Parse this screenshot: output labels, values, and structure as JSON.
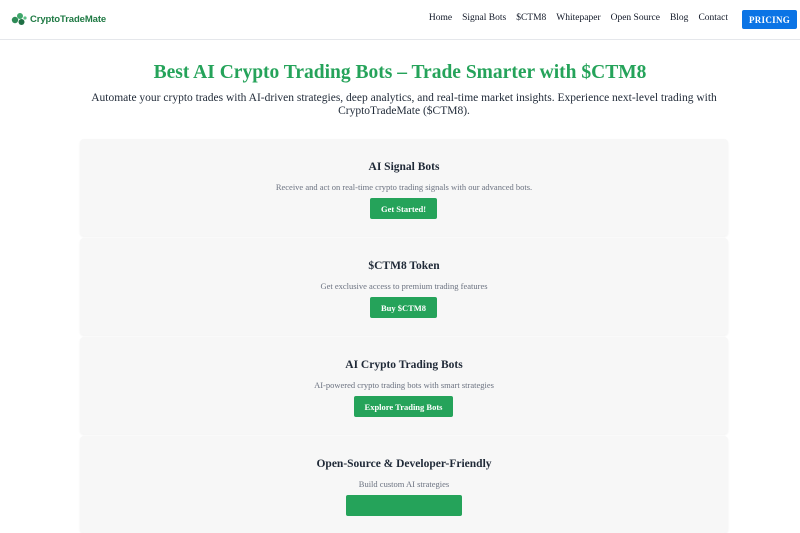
{
  "header": {
    "logo_text": "CryptoTradeMate",
    "nav": [
      "Home",
      "Signal Bots",
      "$CTM8",
      "Whitepaper",
      "Open Source",
      "Blog",
      "Contact"
    ],
    "pricing_label": "PRICING",
    "brand_color": "#25a35a",
    "pricing_color": "#0b74e5"
  },
  "hero": {
    "title": "Best AI Crypto Trading Bots – Trade Smarter with $CTM8",
    "subtitle": "Automate your crypto trades with AI-driven strategies, deep analytics, and real-time market insights. Experience next-level trading with CryptoTradeMate ($CTM8)."
  },
  "cards": [
    {
      "title": "AI Signal Bots",
      "description": "Receive and act on real-time crypto trading signals with our advanced bots.",
      "button": "Get Started!"
    },
    {
      "title": "$CTM8 Token",
      "description": "Get exclusive access to premium trading features",
      "button": "Buy $CTM8"
    },
    {
      "title": "AI Crypto Trading Bots",
      "description": "AI-powered crypto trading bots with smart strategies",
      "button": "Explore Trading Bots"
    },
    {
      "title": "Open-Source & Developer-Friendly",
      "description": "Build custom AI strategies",
      "button": ""
    }
  ]
}
